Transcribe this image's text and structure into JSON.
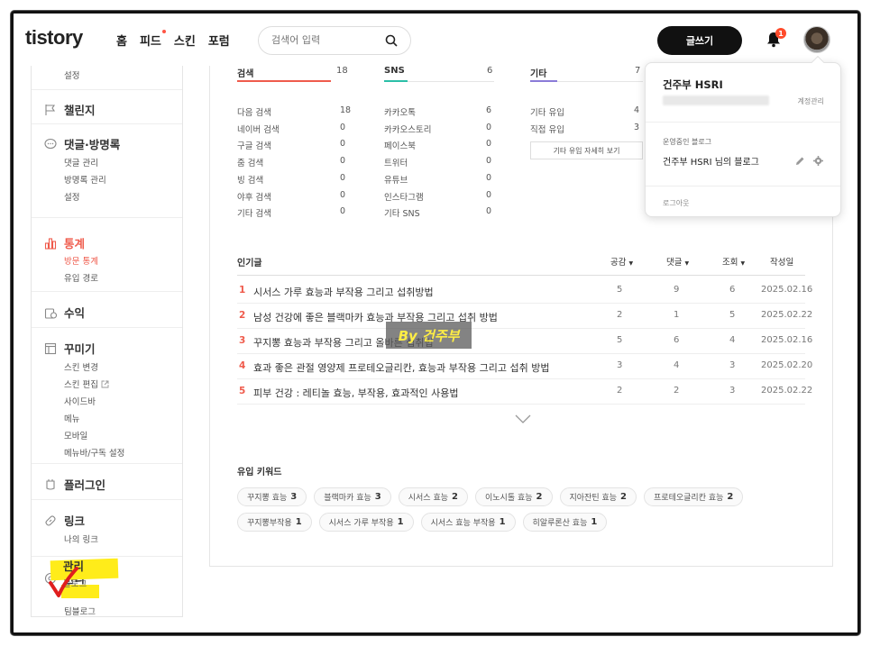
{
  "header": {
    "logo": "tistory",
    "nav": [
      "홈",
      "피드",
      "스킨",
      "포럼"
    ],
    "search_placeholder": "검색어 입력",
    "write_label": "글쓰기",
    "notification_count": "1"
  },
  "sidebar": {
    "top_item": "설정",
    "sections": [
      {
        "title": "챌린지",
        "items": []
      },
      {
        "title": "댓글·방명록",
        "items": [
          "댓글 관리",
          "방명록 관리",
          "설정"
        ]
      },
      {
        "title": "통계",
        "items": [
          "방문 통계",
          "유입 경로"
        ]
      },
      {
        "title": "수익",
        "items": []
      },
      {
        "title": "꾸미기",
        "items": [
          "스킨 변경",
          "스킨 편집",
          "사이드바",
          "메뉴",
          "모바일",
          "메뉴바/구독 설정"
        ]
      },
      {
        "title": "플러그인",
        "items": []
      },
      {
        "title": "링크",
        "items": [
          "나의 링크"
        ]
      },
      {
        "title": "관리",
        "items": [
          "블로그",
          "팀블로그"
        ]
      }
    ]
  },
  "inflow": {
    "search": {
      "title": "검색",
      "count": "18",
      "rows": [
        [
          "다음 검색",
          "18"
        ],
        [
          "네이버 검색",
          "0"
        ],
        [
          "구글 검색",
          "0"
        ],
        [
          "줌 검색",
          "0"
        ],
        [
          "빙 검색",
          "0"
        ],
        [
          "야후 검색",
          "0"
        ],
        [
          "기타 검색",
          "0"
        ]
      ]
    },
    "sns": {
      "title": "SNS",
      "count": "6",
      "rows": [
        [
          "카카오톡",
          "6"
        ],
        [
          "카카오스토리",
          "0"
        ],
        [
          "페이스북",
          "0"
        ],
        [
          "트위터",
          "0"
        ],
        [
          "유튜브",
          "0"
        ],
        [
          "인스타그램",
          "0"
        ],
        [
          "기타 SNS",
          "0"
        ]
      ]
    },
    "etc": {
      "title": "기타",
      "count": "7",
      "rows": [
        [
          "기타 유입",
          "4"
        ],
        [
          "직접 유입",
          "3"
        ]
      ],
      "detail_button": "기타 유입 자세히 보기"
    }
  },
  "popular": {
    "title": "인기글",
    "headers": {
      "likes": "공감",
      "comments": "댓글",
      "views": "조회",
      "date": "작성일"
    },
    "rows": [
      {
        "rank": "1",
        "title": "시서스 가루 효능과 부작용 그리고 섭취방법",
        "likes": "5",
        "comments": "9",
        "views": "6",
        "date": "2025.02.16"
      },
      {
        "rank": "2",
        "title": "남성 건강에 좋은 블랙마카 효능과 부작용 그리고 섭취 방법",
        "likes": "2",
        "comments": "1",
        "views": "5",
        "date": "2025.02.22"
      },
      {
        "rank": "3",
        "title": "꾸지뽕 효능과 부작용 그리고 올바른 섭취법",
        "likes": "5",
        "comments": "6",
        "views": "4",
        "date": "2025.02.16"
      },
      {
        "rank": "4",
        "title": "효과 좋은 관절 영양제 프로테오글리칸, 효능과 부작용 그리고 섭취 방법",
        "likes": "3",
        "comments": "4",
        "views": "3",
        "date": "2025.02.20"
      },
      {
        "rank": "5",
        "title": "피부 건강 : 레티놀 효능, 부작용, 효과적인 사용법",
        "likes": "2",
        "comments": "2",
        "views": "3",
        "date": "2025.02.22"
      }
    ]
  },
  "keywords": {
    "title": "유입 키워드",
    "items": [
      {
        "label": "꾸지뽕 효능",
        "count": "3"
      },
      {
        "label": "블랙마카 효능",
        "count": "3"
      },
      {
        "label": "시서스 효능",
        "count": "2"
      },
      {
        "label": "이노시톨 효능",
        "count": "2"
      },
      {
        "label": "지아잔틴 효능",
        "count": "2"
      },
      {
        "label": "프로테오글리칸 효능",
        "count": "2"
      },
      {
        "label": "꾸지뽕부작용",
        "count": "1"
      },
      {
        "label": "시서스 가루 부작용",
        "count": "1"
      },
      {
        "label": "시서스 효능 부작용",
        "count": "1"
      },
      {
        "label": "히알루론산 효능",
        "count": "1"
      }
    ]
  },
  "watermark": "By 건주부",
  "dropdown": {
    "name": "건주부 HSRI",
    "account_manage": "계정관리",
    "running_blog_label": "운영중인 블로그",
    "blog_name": "건주부 HSRI 님의 블로그",
    "logout": "로그아웃"
  },
  "colors": {
    "accent": "#ef5b4c",
    "highlight": "#ffec1a",
    "search_line": "#ef5b4c",
    "sns_line": "#2bbfa8",
    "etc_line": "#8a7bd8"
  }
}
